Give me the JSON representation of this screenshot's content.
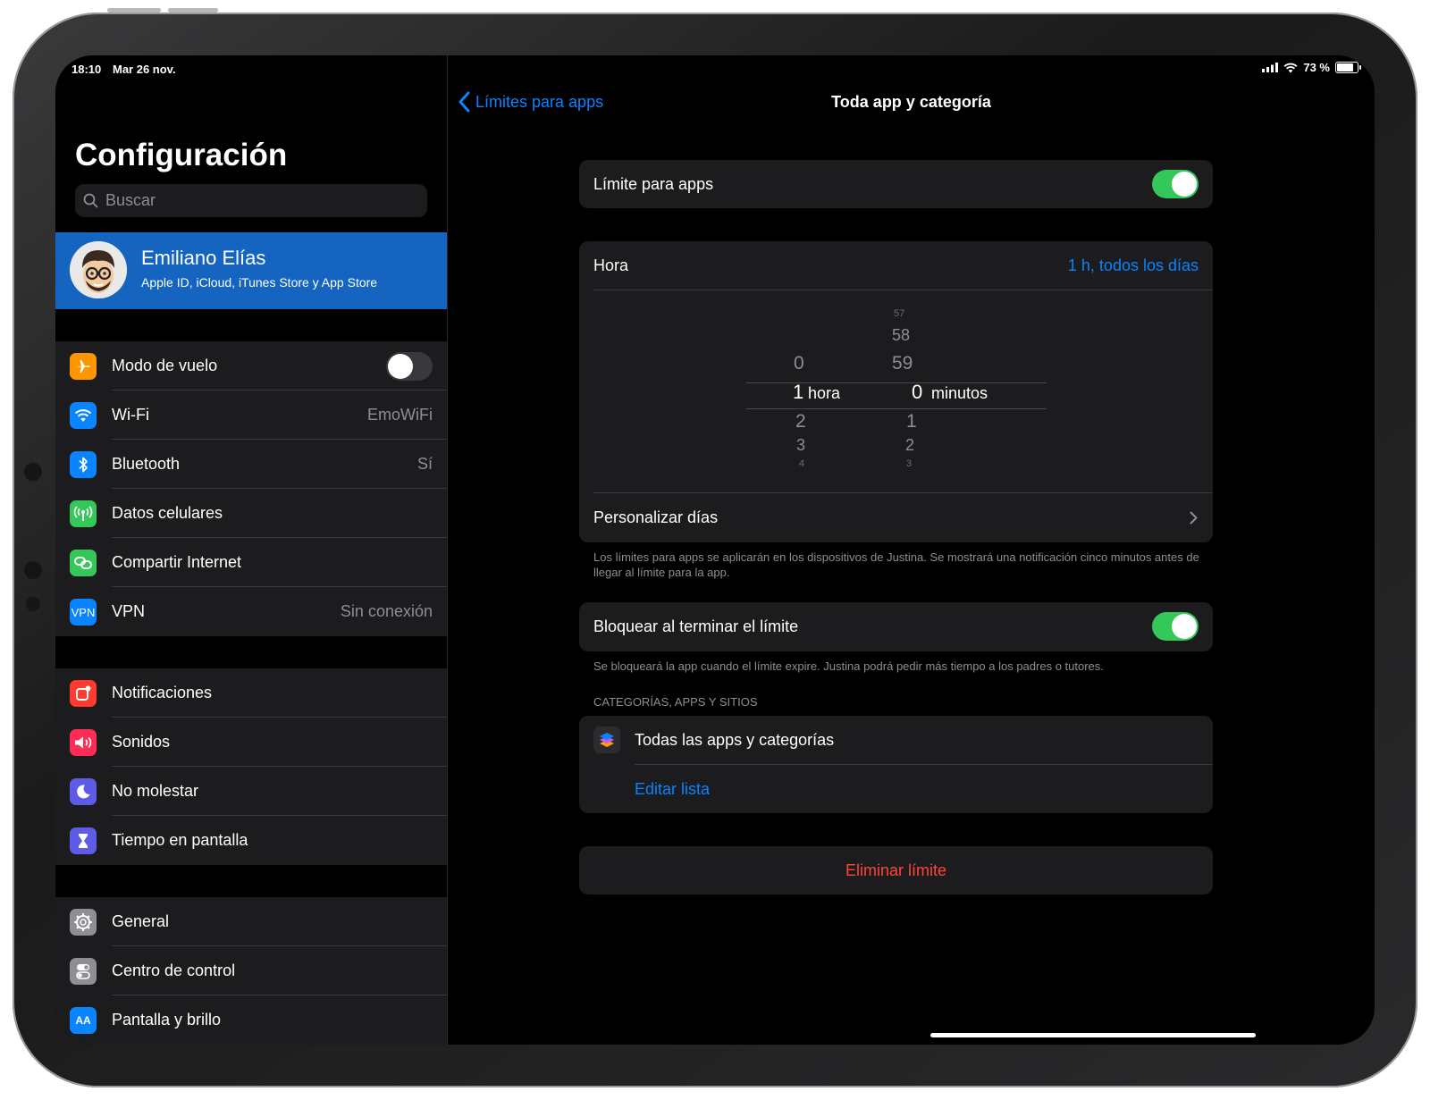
{
  "status": {
    "time": "18:10",
    "date": "Mar 26 nov.",
    "battery": "73 %",
    "battery_level": 0.73
  },
  "sidebar": {
    "title": "Configuración",
    "search_placeholder": "Buscar",
    "profile": {
      "name": "Emiliano Elías",
      "subtitle": "Apple ID, iCloud, iTunes Store y App Store"
    },
    "group1": [
      {
        "label": "Modo de vuelo",
        "value": "",
        "toggle": "off",
        "icon": "airplane-icon",
        "color": "#ff9500"
      },
      {
        "label": "Wi-Fi",
        "value": "EmoWiFi",
        "icon": "wifi-icon",
        "color": "#0a84ff"
      },
      {
        "label": "Bluetooth",
        "value": "Sí",
        "icon": "bluetooth-icon",
        "color": "#0a84ff"
      },
      {
        "label": "Datos celulares",
        "value": "",
        "icon": "antenna-icon",
        "color": "#34c759"
      },
      {
        "label": "Compartir Internet",
        "value": "",
        "icon": "hotspot-icon",
        "color": "#34c759"
      },
      {
        "label": "VPN",
        "value": "Sin conexión",
        "icon": "vpn-icon",
        "color": "#0a84ff",
        "icon_text": "VPN"
      }
    ],
    "group2": [
      {
        "label": "Notificaciones",
        "icon": "notifications-icon",
        "color": "#ff3b30"
      },
      {
        "label": "Sonidos",
        "icon": "speaker-icon",
        "color": "#ff2d55"
      },
      {
        "label": "No molestar",
        "icon": "moon-icon",
        "color": "#5e5ce6"
      },
      {
        "label": "Tiempo en pantalla",
        "icon": "hourglass-icon",
        "color": "#5e5ce6"
      }
    ],
    "group3": [
      {
        "label": "General",
        "icon": "gear-icon",
        "color": "#8e8e93"
      },
      {
        "label": "Centro de control",
        "icon": "switches-icon",
        "color": "#8e8e93"
      },
      {
        "label": "Pantalla y brillo",
        "icon": "display-icon",
        "color": "#0a84ff"
      }
    ]
  },
  "detail": {
    "back_label": "Límites para apps",
    "title": "Toda app y categoría",
    "app_limit_label": "Límite para apps",
    "app_limit_on": true,
    "time_label": "Hora",
    "time_value": "1 h, todos los días",
    "picker": {
      "hours_above": [
        "0"
      ],
      "hours_selected": "1",
      "hours_unit": "hora",
      "hours_below": [
        "2",
        "3",
        "4"
      ],
      "minutes_above": [
        "57",
        "58",
        "59"
      ],
      "minutes_selected": "0",
      "minutes_unit": "minutos",
      "minutes_below": [
        "1",
        "2",
        "3"
      ]
    },
    "customize_days": "Personalizar días",
    "footnote1": "Los límites para apps se aplicarán en los dispositivos de Justina. Se mostrará una notificación cinco minutos antes de llegar al límite para la app.",
    "block_label": "Bloquear al terminar el límite",
    "block_on": true,
    "footnote2": "Se bloqueará la app cuando el límite expire. Justina podrá pedir más tiempo a los padres o tutores.",
    "section_header": "CATEGORÍAS, APPS Y SITIOS",
    "all_apps_label": "Todas las apps y categorías",
    "edit_list": "Editar lista",
    "delete_limit": "Eliminar límite"
  },
  "colors": {
    "accent": "#0a84ff",
    "toggle_on": "#34c759",
    "destructive": "#ff453a",
    "profile_bg": "#1565c0"
  }
}
